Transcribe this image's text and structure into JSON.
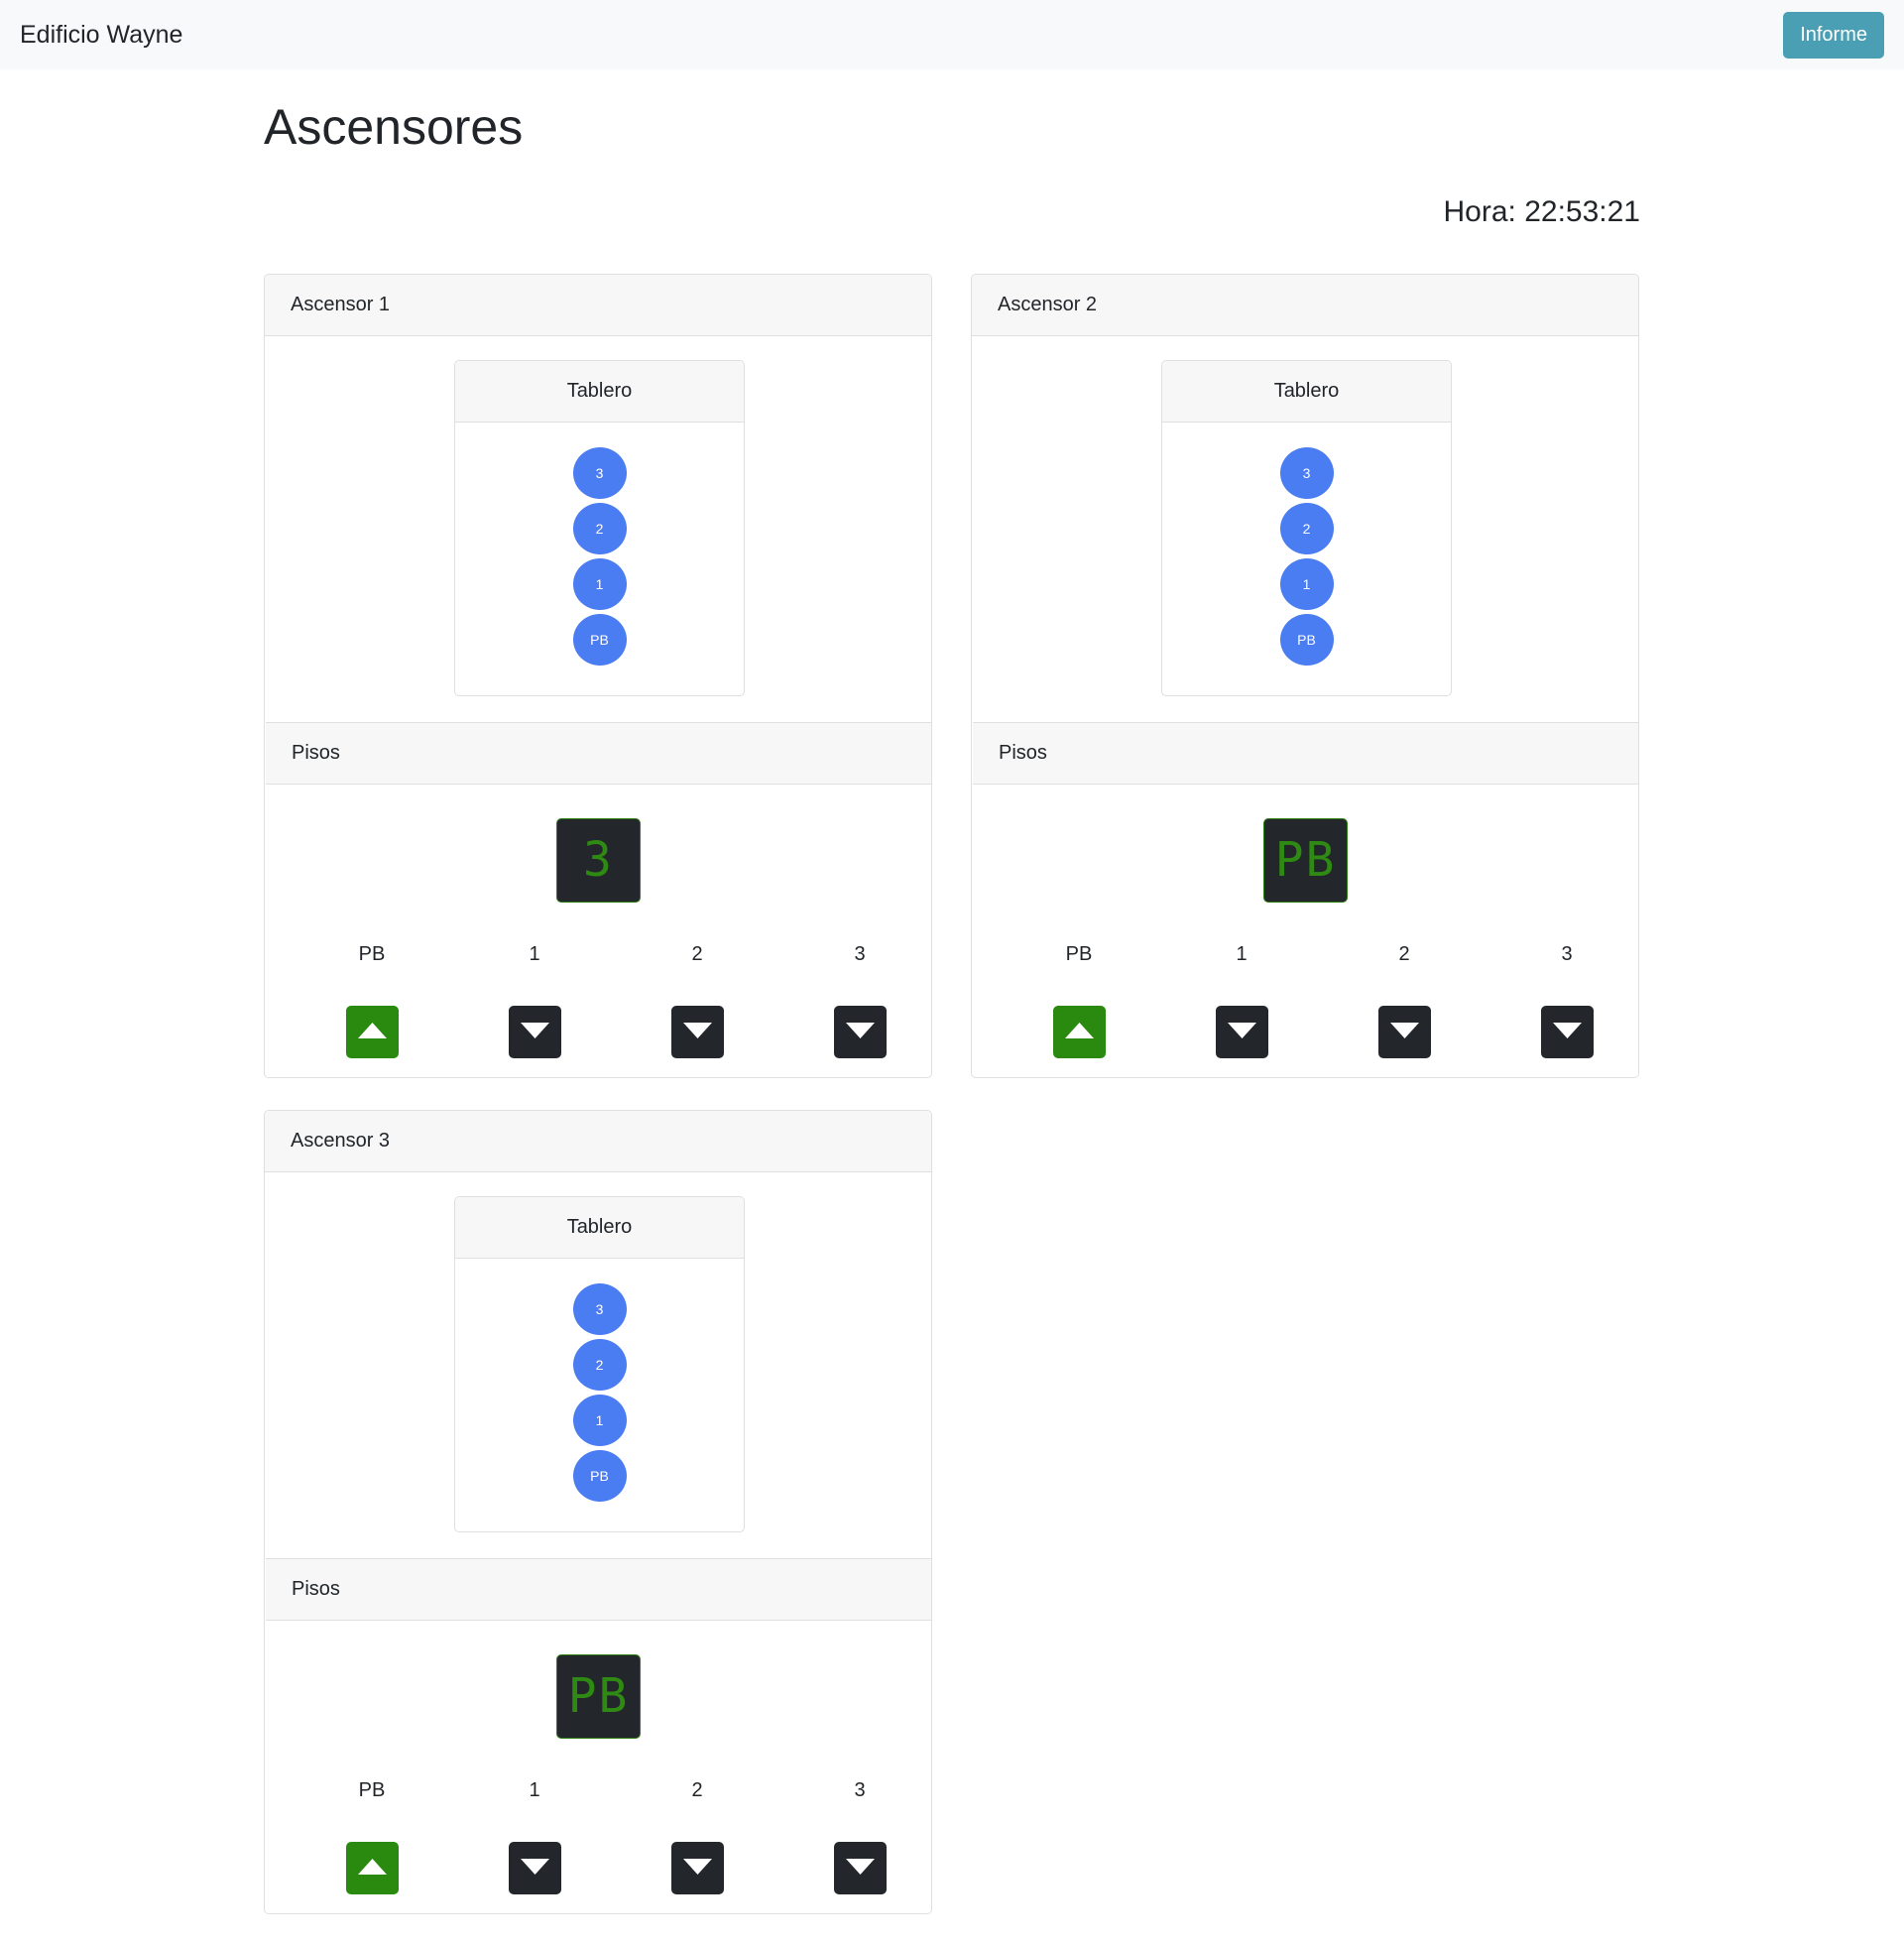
{
  "navbar": {
    "brand": "Edificio Wayne",
    "report_button": "Informe"
  },
  "page": {
    "title": "Ascensores",
    "clock_label": "Hora:",
    "clock_value": "22:53:21",
    "clock_text": "Hora: 22:53:21"
  },
  "colors": {
    "floor_button": "#4a7cf2",
    "call_up": "#2a8a0f",
    "call_down": "#23272b",
    "display_text": "#2f8a14",
    "report_button": "#4a9fb5"
  },
  "elevators": [
    {
      "title": "Ascensor 1",
      "tablero": {
        "title": "Tablero",
        "buttons": [
          "3",
          "2",
          "1",
          "PB"
        ]
      },
      "pisos": {
        "title": "Pisos",
        "display": "3",
        "calls": [
          {
            "floor": "PB",
            "icon": "arrow-up-icon"
          },
          {
            "floor": "1",
            "icon": "arrow-down-icon"
          },
          {
            "floor": "2",
            "icon": "arrow-down-icon"
          },
          {
            "floor": "3",
            "icon": "arrow-down-icon"
          }
        ]
      }
    },
    {
      "title": "Ascensor 2",
      "tablero": {
        "title": "Tablero",
        "buttons": [
          "3",
          "2",
          "1",
          "PB"
        ]
      },
      "pisos": {
        "title": "Pisos",
        "display": "PB",
        "calls": [
          {
            "floor": "PB",
            "icon": "arrow-up-icon"
          },
          {
            "floor": "1",
            "icon": "arrow-down-icon"
          },
          {
            "floor": "2",
            "icon": "arrow-down-icon"
          },
          {
            "floor": "3",
            "icon": "arrow-down-icon"
          }
        ]
      }
    },
    {
      "title": "Ascensor 3",
      "tablero": {
        "title": "Tablero",
        "buttons": [
          "3",
          "2",
          "1",
          "PB"
        ]
      },
      "pisos": {
        "title": "Pisos",
        "display": "PB",
        "calls": [
          {
            "floor": "PB",
            "icon": "arrow-up-icon"
          },
          {
            "floor": "1",
            "icon": "arrow-down-icon"
          },
          {
            "floor": "2",
            "icon": "arrow-down-icon"
          },
          {
            "floor": "3",
            "icon": "arrow-down-icon"
          }
        ]
      }
    }
  ]
}
